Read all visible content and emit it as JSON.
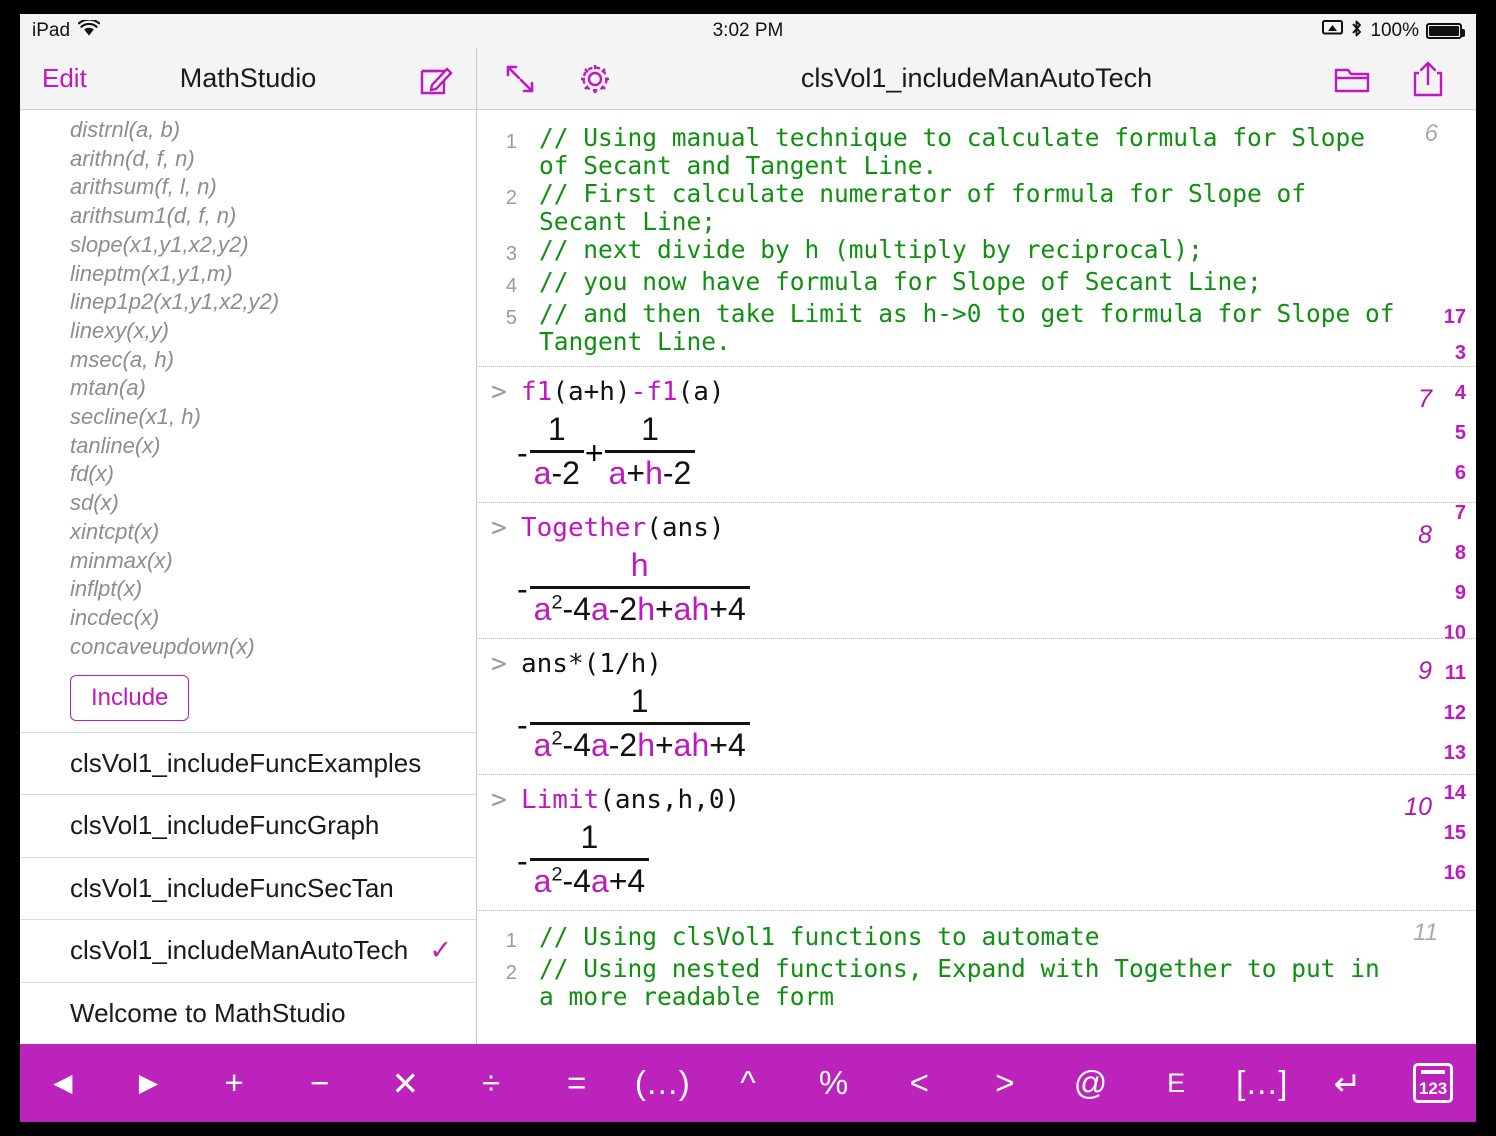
{
  "status_bar": {
    "device": "iPad",
    "wifi_icon": "wifi-icon",
    "time": "3:02 PM",
    "airplay_icon": "airplay-icon",
    "bluetooth_icon": "bluetooth-icon",
    "battery_percent": "100%",
    "battery_icon": "battery-icon"
  },
  "sidebar": {
    "edit_label": "Edit",
    "title": "MathStudio",
    "compose_icon": "compose-icon",
    "functions": [
      "distrnl(a, b)",
      "arithn(d, f, n)",
      "arithsum(f, l, n)",
      "arithsum1(d, f, n)",
      "slope(x1,y1,x2,y2)",
      "lineptm(x1,y1,m)",
      "linep1p2(x1,y1,x2,y2)",
      "linexy(x,y)",
      "msec(a, h)",
      "mtan(a)",
      "secline(x1, h)",
      "tanline(x)",
      "fd(x)",
      "sd(x)",
      "xintcpt(x)",
      "minmax(x)",
      "inflpt(x)",
      "incdec(x)",
      "concaveupdown(x)"
    ],
    "include_button": "Include",
    "documents": [
      {
        "name": "clsVol1_includeFuncExamples",
        "selected": false,
        "check": ""
      },
      {
        "name": "clsVol1_includeFuncGraph",
        "selected": false,
        "check": ""
      },
      {
        "name": "clsVol1_includeFuncSecTan",
        "selected": false,
        "check": ""
      },
      {
        "name": "clsVol1_includeManAutoTech",
        "selected": true,
        "check": "✓"
      },
      {
        "name": "Welcome to MathStudio",
        "selected": false,
        "check": ""
      }
    ]
  },
  "editor_toolbar": {
    "expand_icon": "expand-arrows-icon",
    "settings_icon": "gear-icon",
    "title": "clsVol1_includeManAutoTech",
    "folder_icon": "folder-icon",
    "share_icon": "share-icon"
  },
  "worksheet": {
    "comment_block_top": {
      "cell_number": "6",
      "lines": [
        {
          "n": "1",
          "text": "// Using manual technique  to calculate formula for Slope of Secant and Tangent Line."
        },
        {
          "n": "2",
          "text": "// First calculate numerator of formula for Slope of Secant Line;"
        },
        {
          "n": "3",
          "text": "// next divide by h (multiply by reciprocal);"
        },
        {
          "n": "4",
          "text": "// you now have formula for Slope of Secant Line;"
        },
        {
          "n": "5",
          "text": "// and then take Limit as h->0 to get formula for Slope of Tangent Line."
        }
      ]
    },
    "cells": [
      {
        "cell_number": "7",
        "prompt_chevron": ">",
        "input_parts": [
          {
            "t": "f1",
            "c": "magenta"
          },
          {
            "t": "(a+h)",
            "c": "black"
          },
          {
            "t": "-",
            "c": "magenta"
          },
          {
            "t": "f1",
            "c": "magenta"
          },
          {
            "t": "(a)",
            "c": "black"
          }
        ],
        "input_plain": "f1(a+h)-f1(a)",
        "result_sign": "-",
        "result_type": "sum_of_fractions",
        "frac1_num": "1",
        "frac1_den": "a-2",
        "middle_op": "+",
        "frac2_num": "1",
        "frac2_den": "a+h-2"
      },
      {
        "cell_number": "8",
        "prompt_chevron": ">",
        "input_plain": "Together(ans)",
        "input_func": "Together",
        "input_args": "(ans)",
        "result_sign": "-",
        "result_type": "single_fraction",
        "frac_num": "h",
        "frac_den": "a2-4a-2h+ah+4"
      },
      {
        "cell_number": "9",
        "prompt_chevron": ">",
        "input_plain": "ans*(1/h)",
        "result_sign": "-",
        "result_type": "single_fraction",
        "frac_num": "1",
        "frac_den": "a2-4a-2h+ah+4"
      },
      {
        "cell_number": "10",
        "prompt_chevron": ">",
        "input_plain": "Limit(ans,h,0)",
        "input_func": "Limit",
        "input_args": "(ans,h,0)",
        "result_sign": "-",
        "result_type": "single_fraction",
        "frac_num": "1",
        "frac_den": "a2-4a+4"
      }
    ],
    "comment_block_bottom": {
      "cell_number": "11",
      "lines": [
        {
          "n": "1",
          "text": "// Using clsVol1 functions to automate"
        },
        {
          "n": "2",
          "text": "// Using nested functions, Expand with Together to put in a more readable form"
        }
      ]
    },
    "gutter_line_numbers": [
      "17",
      "3",
      "4",
      "5",
      "6",
      "7",
      "8",
      "9",
      "10",
      "11",
      "12",
      "13",
      "14",
      "15",
      "16"
    ]
  },
  "keyboard_bar": {
    "keys": [
      {
        "label": "◀",
        "name": "cursor-left"
      },
      {
        "label": "▶",
        "name": "cursor-right"
      },
      {
        "label": "+",
        "name": "plus"
      },
      {
        "label": "−",
        "name": "minus"
      },
      {
        "label": "✕",
        "name": "multiply"
      },
      {
        "label": "÷",
        "name": "divide"
      },
      {
        "label": "=",
        "name": "equals"
      },
      {
        "label": "(…)",
        "name": "parentheses"
      },
      {
        "label": "^",
        "name": "power"
      },
      {
        "label": "%",
        "name": "percent"
      },
      {
        "label": "<",
        "name": "less-than"
      },
      {
        "label": ">",
        "name": "greater-than"
      },
      {
        "label": "@",
        "name": "at"
      },
      {
        "label": "E",
        "name": "exponent-e"
      },
      {
        "label": "[…]",
        "name": "brackets"
      },
      {
        "label": "↵",
        "name": "return"
      },
      {
        "label": "123",
        "name": "numeric-keypad"
      }
    ]
  },
  "colors": {
    "accent": "#c018c0",
    "keybar": "#bc22bc",
    "comment_green": "#109010",
    "chrome": "#f4f4f4"
  }
}
